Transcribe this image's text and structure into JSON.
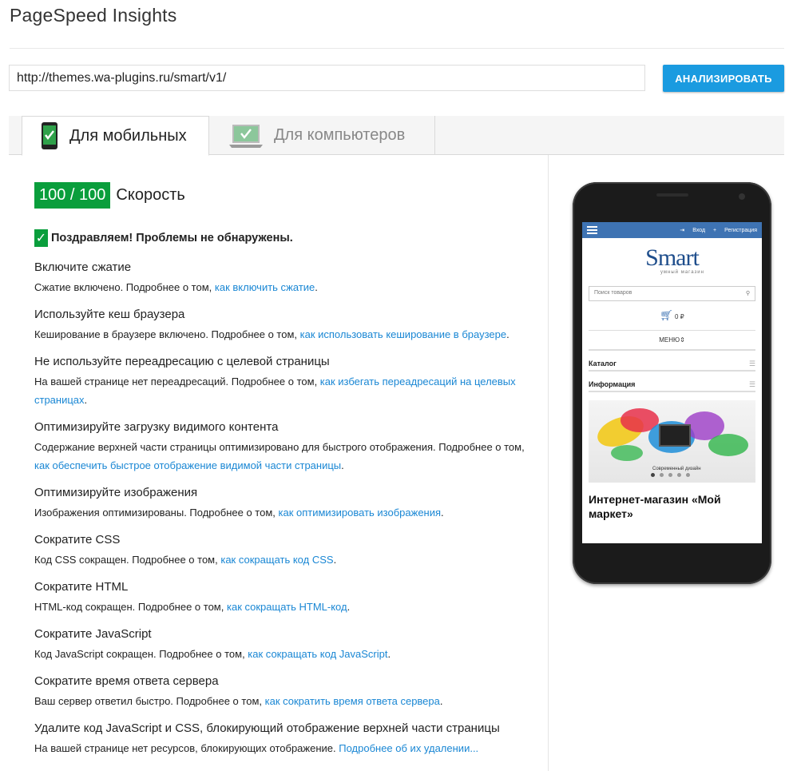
{
  "app": {
    "title": "PageSpeed Insights"
  },
  "search": {
    "url": "http://themes.wa-plugins.ru/smart/v1/",
    "button": "АНАЛИЗИРОВАТЬ"
  },
  "tabs": [
    {
      "label": "Для мобильных",
      "active": true
    },
    {
      "label": "Для компьютеров",
      "active": false
    }
  ],
  "score": {
    "value": "100 / 100",
    "label": "Скорость",
    "color": "#0a9e3c"
  },
  "congrats": {
    "check": "✓",
    "text": "Поздравляем! Проблемы не обнаружены."
  },
  "rules": [
    {
      "title": "Включите сжатие",
      "text": "Сжатие включено. Подробнее о том, ",
      "link": "как включить сжатие",
      "after": "."
    },
    {
      "title": "Используйте кеш браузера",
      "text": "Кеширование в браузере включено. Подробнее о том, ",
      "link": "как использовать кеширование в браузере",
      "after": "."
    },
    {
      "title": "Не используйте переадресацию с целевой страницы",
      "text": "На вашей странице нет переадресаций. Подробнее о том, ",
      "link": "как избегать переадресаций на целевых страницах",
      "after": "."
    },
    {
      "title": "Оптимизируйте загрузку видимого контента",
      "text": "Содержание верхней части страницы оптимизировано для быстрого отображения. Подробнее о том, ",
      "link": "как обеспечить быстрое отображение видимой части страницы",
      "after": "."
    },
    {
      "title": "Оптимизируйте изображения",
      "text": "Изображения оптимизированы. Подробнее о том, ",
      "link": "как оптимизировать изображения",
      "after": "."
    },
    {
      "title": "Сократите CSS",
      "text": "Код CSS сокращен. Подробнее о том, ",
      "link": "как сокращать код CSS",
      "after": "."
    },
    {
      "title": "Сократите HTML",
      "text": "HTML-код сокращен. Подробнее о том, ",
      "link": "как сокращать HTML-код",
      "after": "."
    },
    {
      "title": "Сократите JavaScript",
      "text": "Код JavaScript сокращен. Подробнее о том, ",
      "link": "как сокращать код JavaScript",
      "after": "."
    },
    {
      "title": "Сократите время ответа сервера",
      "text": "Ваш сервер ответил быстро. Подробнее о том, ",
      "link": "как сократить время ответа сервера",
      "after": "."
    },
    {
      "title": "Удалите код JavaScript и CSS, блокирующий отображение верхней части страницы",
      "text": "На вашей странице нет ресурсов, блокирующих отображение. ",
      "link": "Подробнее об их удалении...",
      "after": ""
    }
  ],
  "preview": {
    "login": "Вход",
    "register": "Регистрация",
    "logo": "Smart",
    "logo_sub": "умный магазин",
    "search_placeholder": "Поиск товаров",
    "cart": "0 ₽",
    "menu": "МЕНЮ",
    "sections": [
      "Каталог",
      "Информация"
    ],
    "banner_caption": "Современный дизайн",
    "headline": "Интернет-магазин «Мой маркет»"
  }
}
